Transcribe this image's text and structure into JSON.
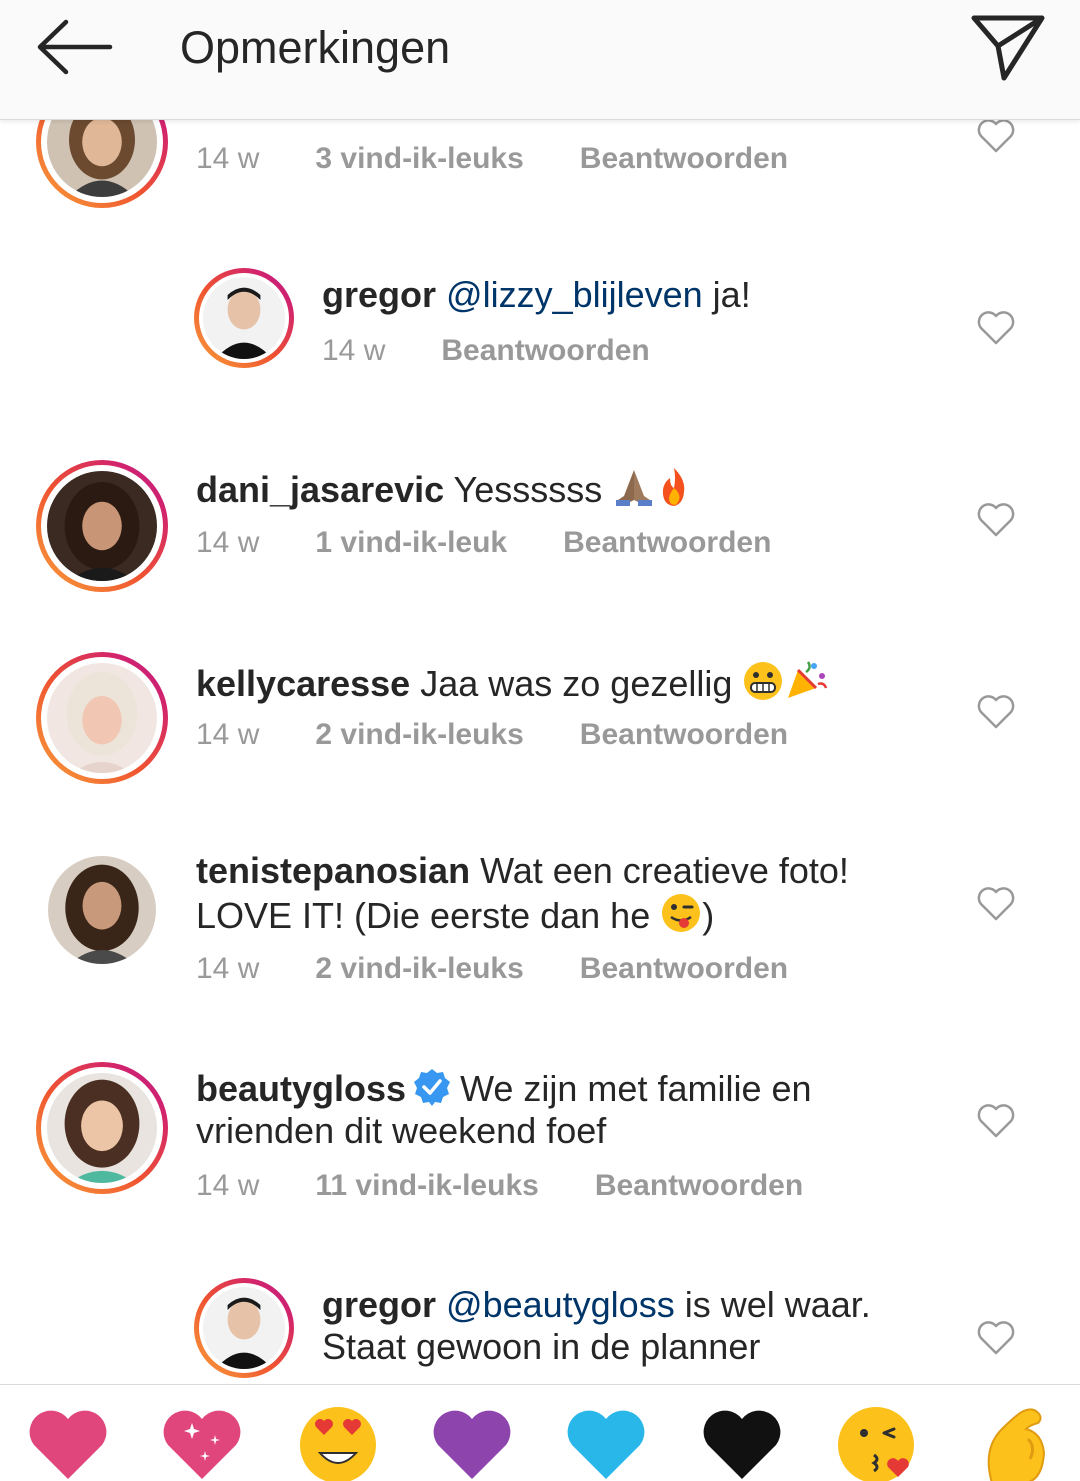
{
  "header": {
    "title": "Opmerkingen",
    "back_icon": "arrow-left-icon",
    "send_icon": "paper-plane-icon"
  },
  "comments": [
    {
      "time": "14 w",
      "likes": "3 vind-ik-leuks",
      "reply": "Beantwoorden"
    },
    {
      "username": "gregor",
      "mention": "@lizzy_blijleven",
      "text": " ja!",
      "time": "14 w",
      "reply": "Beantwoorden"
    },
    {
      "username": "dani_jasarevic",
      "text": " Yessssss ",
      "emojis": [
        "folded-hands-emoji",
        "fire-emoji"
      ],
      "time": "14 w",
      "likes": "1 vind-ik-leuk",
      "reply": "Beantwoorden"
    },
    {
      "username": "kellycaresse",
      "text": " Jaa was zo gezellig ",
      "emojis": [
        "grinning-face-emoji",
        "party-popper-emoji"
      ],
      "time": "14 w",
      "likes": "2 vind-ik-leuks",
      "reply": "Beantwoorden"
    },
    {
      "username": "tenistepanosian",
      "text": " Wat een creatieve foto! LOVE IT! (Die eerste dan he ",
      "text_end": ")",
      "emojis": [
        "winking-tongue-emoji"
      ],
      "time": "14 w",
      "likes": "2 vind-ik-leuks",
      "reply": "Beantwoorden"
    },
    {
      "username": "beautygloss",
      "verified": true,
      "text": "We zijn met familie en vrienden dit weekend foef",
      "time": "14 w",
      "likes": "11 vind-ik-leuks",
      "reply": "Beantwoorden"
    },
    {
      "username": "gregor",
      "mention": "@beautygloss",
      "text": " is wel waar. Staat gewoon in de planner"
    }
  ],
  "quick_emojis": [
    "pink-heart-emoji",
    "sparkling-heart-emoji",
    "heart-eyes-emoji",
    "purple-heart-emoji",
    "blue-heart-emoji",
    "black-heart-emoji",
    "kissing-heart-emoji",
    "flexed-biceps-emoji"
  ],
  "colors": {
    "mention": "#003569",
    "meta": "#999999",
    "ring_start": "#f9a13a",
    "ring_end": "#b41f8e"
  }
}
